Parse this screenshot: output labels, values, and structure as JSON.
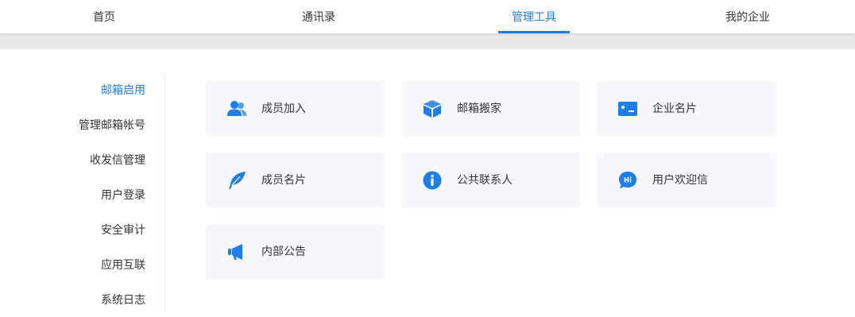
{
  "topnav": {
    "tabs": [
      {
        "label": "首页"
      },
      {
        "label": "通讯录"
      },
      {
        "label": "管理工具"
      },
      {
        "label": "我的企业"
      }
    ],
    "active_tab": "管理工具"
  },
  "sidebar": {
    "items": [
      {
        "label": "邮箱启用"
      },
      {
        "label": "管理邮箱帐号"
      },
      {
        "label": "收发信管理"
      },
      {
        "label": "用户登录"
      },
      {
        "label": "安全审计"
      },
      {
        "label": "应用互联"
      },
      {
        "label": "系统日志"
      }
    ],
    "active_item": "邮箱启用"
  },
  "tools": {
    "cards": [
      {
        "label": "成员加入",
        "icon": "users-icon"
      },
      {
        "label": "邮箱搬家",
        "icon": "box-icon"
      },
      {
        "label": "企业名片",
        "icon": "id-card-icon"
      },
      {
        "label": "成员名片",
        "icon": "feather-icon"
      },
      {
        "label": "公共联系人",
        "icon": "info-icon"
      },
      {
        "label": "用户欢迎信",
        "icon": "hi-chat-icon"
      },
      {
        "label": "内部公告",
        "icon": "megaphone-icon"
      }
    ]
  },
  "colors": {
    "accent": "#1e7ee8",
    "card_bg": "#f6f8fb",
    "band": "#e9e9e9"
  }
}
